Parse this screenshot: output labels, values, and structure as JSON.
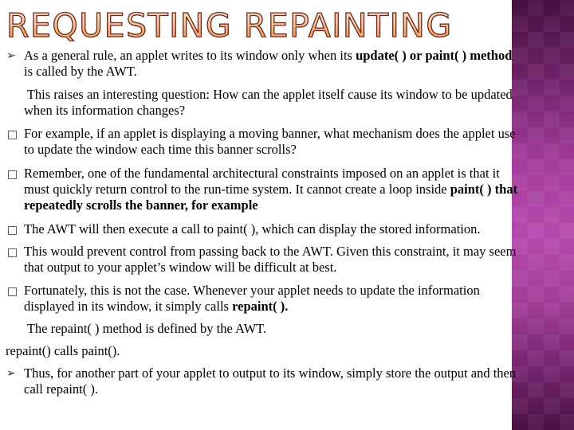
{
  "slide": {
    "title": "REQUESTING REPAINTING",
    "accent_band_color": "#a43c9c",
    "title_fill_color": "#f8c9a0",
    "title_outline_color": "#6b2a20"
  },
  "bullets": [
    {
      "icon": "arrow-bullet-icon",
      "lines": [
        {
          "parts": [
            {
              "text": "As a general rule, an applet writes to its window only when its ",
              "bold": false
            },
            {
              "text": "update( ) or paint( ) method",
              "bold": true
            }
          ]
        },
        {
          "parts": [
            {
              "text": "is called by the AWT.",
              "bold": false
            }
          ]
        }
      ]
    },
    {
      "icon": "none",
      "lines": [
        {
          "parts": [
            {
              "text": " This raises an interesting question: How can the applet itself cause its window to be updated",
              "bold": false
            }
          ]
        },
        {
          "parts": [
            {
              "text": "when its information changes?",
              "bold": false
            }
          ]
        }
      ]
    },
    {
      "icon": "square-bullet-icon",
      "lines": [
        {
          "parts": [
            {
              "text": "For example, if an applet is displaying a moving banner, what mechanism does the applet use",
              "bold": false
            }
          ]
        },
        {
          "parts": [
            {
              "text": "to update the window each time this banner scrolls?",
              "bold": false
            }
          ]
        }
      ]
    },
    {
      "icon": "square-bullet-icon",
      "lines": [
        {
          "parts": [
            {
              "text": "Remember, one of the fundamental architectural constraints imposed on an applet is that it",
              "bold": false
            }
          ]
        },
        {
          "parts": [
            {
              "text": "must quickly return control to the run-time system. It cannot create a loop inside ",
              "bold": false
            },
            {
              "text": "paint( ) that",
              "bold": true
            }
          ]
        },
        {
          "parts": [
            {
              "text": "repeatedly scrolls the banner, for example",
              "bold": true
            }
          ]
        }
      ]
    },
    {
      "icon": "square-bullet-icon",
      "lines": [
        {
          "parts": [
            {
              "text": "The AWT will then execute a call to paint( ), which can display the stored information.",
              "bold": false
            }
          ]
        }
      ]
    },
    {
      "icon": "square-bullet-icon",
      "lines": [
        {
          "parts": [
            {
              "text": "This would prevent control from passing back to the AWT. Given this constraint, it may seem",
              "bold": false
            }
          ]
        },
        {
          "parts": [
            {
              "text": "that output to your applet’s window will be difficult at best.",
              "bold": false
            }
          ]
        }
      ]
    },
    {
      "icon": "square-bullet-icon",
      "lines": [
        {
          "parts": [
            {
              "text": "Fortunately, this is not the case. Whenever your applet needs to update the information",
              "bold": false
            }
          ]
        },
        {
          "parts": [
            {
              "text": "displayed in its window, it simply calls ",
              "bold": false
            },
            {
              "text": "repaint( ).",
              "bold": true
            }
          ]
        }
      ]
    },
    {
      "icon": "none",
      "lines": [
        {
          "parts": [
            {
              "text": " The repaint( ) method is defined by the AWT.",
              "bold": false
            }
          ]
        }
      ]
    },
    {
      "icon": "none",
      "lines": [
        {
          "parts": [
            {
              "text": "repaint() calls paint().",
              "bold": false
            }
          ]
        }
      ]
    },
    {
      "icon": "arrow-bullet-icon",
      "lines": [
        {
          "parts": [
            {
              "text": "Thus, for another part of your applet to output to its window, simply store the output and then",
              "bold": false
            }
          ]
        },
        {
          "parts": [
            {
              "text": "call repaint( ).",
              "bold": false
            }
          ]
        }
      ]
    }
  ]
}
